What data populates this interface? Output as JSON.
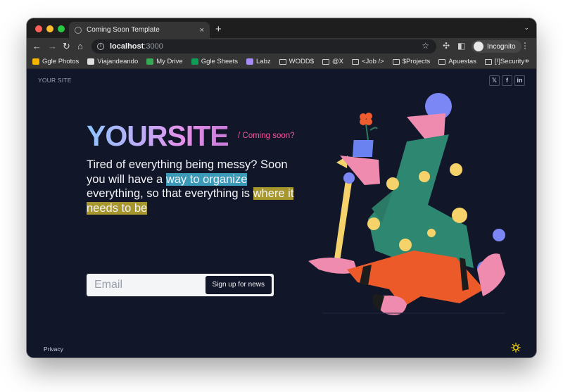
{
  "browser": {
    "tab_title": "Coming Soon Template",
    "close_symbol": "×",
    "new_tab_symbol": "+",
    "url_host": "localhost",
    "url_port": ":3000",
    "profile_label": "Incognito",
    "bookmarks": [
      {
        "label": "Ggle Photos",
        "icon": "photos-icon",
        "color": "#f4b400"
      },
      {
        "label": "Viajandeando",
        "icon": "wordpress-icon",
        "color": "#e0e0e0"
      },
      {
        "label": "My Drive",
        "icon": "drive-icon",
        "color": "#34a853"
      },
      {
        "label": "Ggle Sheets",
        "icon": "sheets-icon",
        "color": "#0f9d58"
      },
      {
        "label": "Labz",
        "icon": "labz-icon",
        "color": "#a78bfa"
      },
      {
        "label": "WODD$",
        "icon": "folder-icon",
        "color": ""
      },
      {
        "label": "@X",
        "icon": "folder-icon",
        "color": ""
      },
      {
        "label": "<Job />",
        "icon": "folder-icon",
        "color": ""
      },
      {
        "label": "$Projects",
        "icon": "folder-icon",
        "color": ""
      },
      {
        "label": "Apuestas",
        "icon": "folder-icon",
        "color": ""
      },
      {
        "label": "[!]Security+",
        "icon": "folder-icon",
        "color": ""
      }
    ],
    "bookmarks_more": "»"
  },
  "page": {
    "site_small": "YOUR SITE",
    "socials": [
      "𝕏",
      "f",
      "in"
    ],
    "logo_your": "YOUR",
    "logo_site": "SITE",
    "coming_soon": "/ Coming soon?",
    "tagline_1": "Tired of everything being messy? Soon you will have a ",
    "tagline_hl1": "way to organize",
    "tagline_2": " everything, so that everything is ",
    "tagline_hl2": "where it needs to be",
    "email_placeholder": "Email",
    "signup_button": "Sign up for news",
    "privacy": "Privacy"
  },
  "colors": {
    "background": "#121629",
    "accent_pink": "#f2579a",
    "highlight_blue": "#3b9ab7",
    "highlight_yellow": "#a7962b",
    "sun": "#f5d500"
  }
}
